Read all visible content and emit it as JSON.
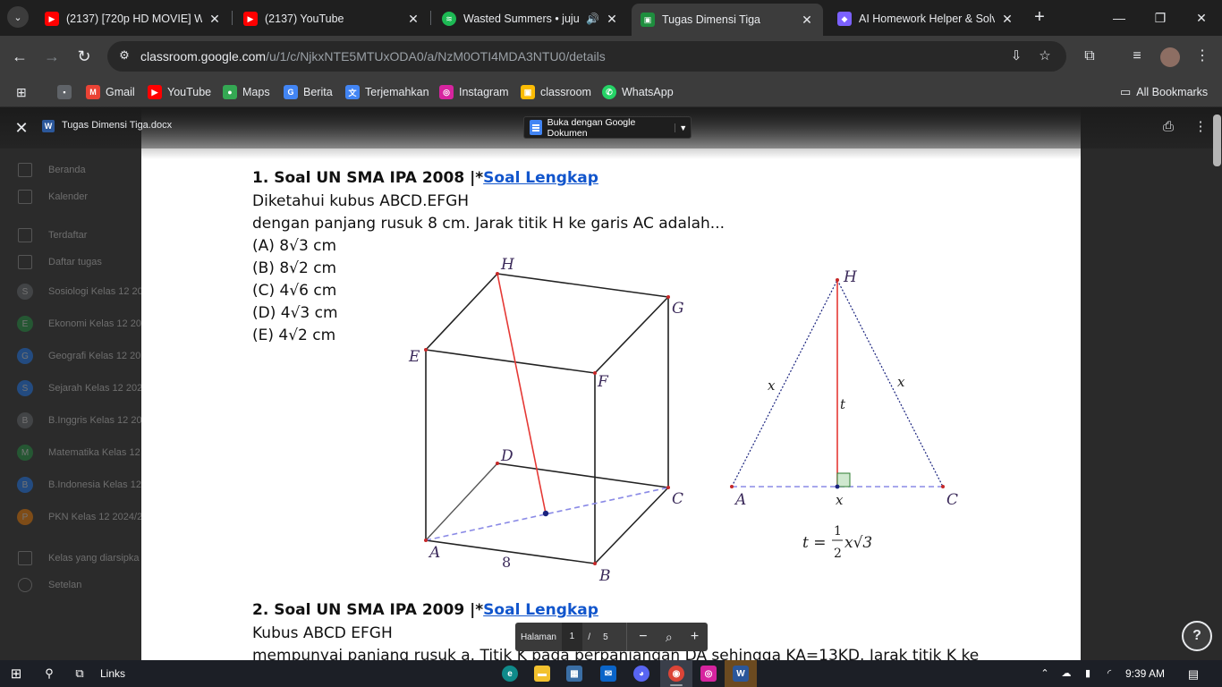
{
  "tabs": [
    {
      "title": "(2137) [720p HD MOVIE] Wa",
      "favicon": "youtube-icon",
      "active": false
    },
    {
      "title": "(2137) YouTube",
      "favicon": "youtube-icon",
      "active": false
    },
    {
      "title": "Wasted Summers • juju",
      "favicon": "spotify-icon",
      "active": false
    },
    {
      "title": "Tugas Dimensi Tiga",
      "favicon": "classroom-icon",
      "active": true
    },
    {
      "title": "AI Homework Helper & Solv",
      "favicon": "ai-helper-icon",
      "active": false
    }
  ],
  "toolbar": {
    "url_host": "classroom.google.com",
    "url_path": "/u/1/c/NjkxNTE5MTUxODA0/a/NzM0OTI4MDA3NTU0/details"
  },
  "bookmarks": {
    "items": [
      "Gmail",
      "YouTube",
      "Maps",
      "Berita",
      "Terjemahkan",
      "Instagram",
      "classroom",
      "WhatsApp"
    ],
    "all_label": "All Bookmarks"
  },
  "classroom_sidebar": {
    "beranda": "Beranda",
    "kalender": "Kalender",
    "terdaftar": "Terdaftar",
    "daftar_tugas": "Daftar tugas",
    "classes": [
      {
        "letter": "S",
        "name": "Sosiologi Kelas 12 20",
        "color": "#5f6368"
      },
      {
        "letter": "E",
        "name": "Ekonomi Kelas 12 20",
        "color": "#1e8e3e"
      },
      {
        "letter": "G",
        "name": "Geografi Kelas 12 20",
        "color": "#1a73e8"
      },
      {
        "letter": "S",
        "name": "Sejarah Kelas 12 202",
        "color": "#1a73e8"
      },
      {
        "letter": "B",
        "name": "B.Inggris Kelas 12 20",
        "color": "#5f6368"
      },
      {
        "letter": "M",
        "name": "Matematika Kelas 12",
        "color": "#1e8e3e"
      },
      {
        "letter": "B",
        "name": "B.Indonesia Kelas 12",
        "color": "#1a73e8"
      },
      {
        "letter": "P",
        "name": "PKN Kelas 12 2024/2",
        "color": "#e37400"
      }
    ],
    "archived": "Kelas yang diarsipka",
    "settings": "Setelan"
  },
  "viewer": {
    "file_name": "Tugas Dimensi Tiga.docx",
    "open_with": "Buka dengan Google Dokumen"
  },
  "document": {
    "q1_title": "1. Soal UN SMA IPA 2008 |*",
    "q1_link": "Soal Lengkap",
    "q1_line1": "Diketahui kubus ABCD.EFGH",
    "q1_line2": "dengan panjang rusuk 8 cm. Jarak titik H ke garis AC adalah...",
    "q1_options": [
      "(A) 8√3 cm",
      "(B) 8√2 cm",
      "(C) 4√6 cm",
      "(D) 4√3 cm",
      "(E) 4√2 cm"
    ],
    "cube_labels": {
      "H": "H",
      "G": "G",
      "E": "E",
      "F": "F",
      "D": "D",
      "C": "C",
      "A": "A",
      "B": "B",
      "edge": "8"
    },
    "triangle_labels": {
      "H": "H",
      "A": "A",
      "C": "C",
      "x_left": "x",
      "x_right": "x",
      "t": "t",
      "x_base": "x"
    },
    "formula_t": "t =",
    "formula_num": "1",
    "formula_den": "2",
    "formula_rest": "x√3",
    "q2_title": "2. Soal UN SMA IPA 2009 |*",
    "q2_link": "Soal Lengkap",
    "q2_line1": "Kubus ABCD EFGH",
    "q2_line2": "mempunyai panjang rusuk a. Titik K pada perpanjangan DA sehingga KA=13KD. Jarak titik K ke"
  },
  "pager": {
    "label": "Halaman",
    "current": "1",
    "separator": "/",
    "total": "5"
  },
  "taskbar": {
    "links": "Links",
    "time": "9:39 AM"
  }
}
